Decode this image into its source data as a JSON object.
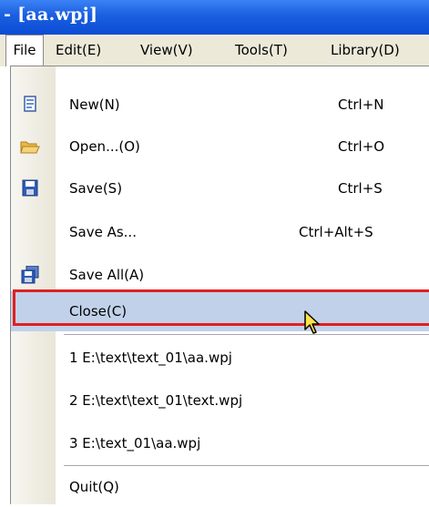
{
  "window": {
    "title": "- [aa.wpj]"
  },
  "menubar": [
    {
      "label": "File"
    },
    {
      "label": "Edit(E)"
    },
    {
      "label": "View(V)"
    },
    {
      "label": "Tools(T)"
    },
    {
      "label": "Library(D)"
    }
  ],
  "file_menu": {
    "items": [
      {
        "label": "New(N)",
        "shortcut": "Ctrl+N",
        "icon": "new-document-icon"
      },
      {
        "label": "Open...(O)",
        "shortcut": "Ctrl+O",
        "icon": "open-folder-icon"
      },
      {
        "label": "Save(S)",
        "shortcut": "Ctrl+S",
        "icon": "save-disk-icon"
      },
      {
        "label": "Save As...",
        "shortcut": "Ctrl+Alt+S",
        "icon": ""
      },
      {
        "label": "Save All(A)",
        "shortcut": "",
        "icon": "save-all-icon"
      },
      {
        "label": "Close(C)",
        "shortcut": "",
        "icon": "",
        "state": "highlighted"
      }
    ],
    "recent_files": [
      {
        "label": "1 E:\\text\\text_01\\aa.wpj"
      },
      {
        "label": "2 E:\\text\\text_01\\text.wpj"
      },
      {
        "label": "3 E:\\text_01\\aa.wpj"
      }
    ],
    "quit": {
      "label": "Quit(Q)"
    }
  },
  "colors": {
    "titlebar": "#0b4cd4",
    "highlight": "#c2d1ea",
    "annotation_box": "#e02020",
    "menubar": "#ece9d8"
  }
}
